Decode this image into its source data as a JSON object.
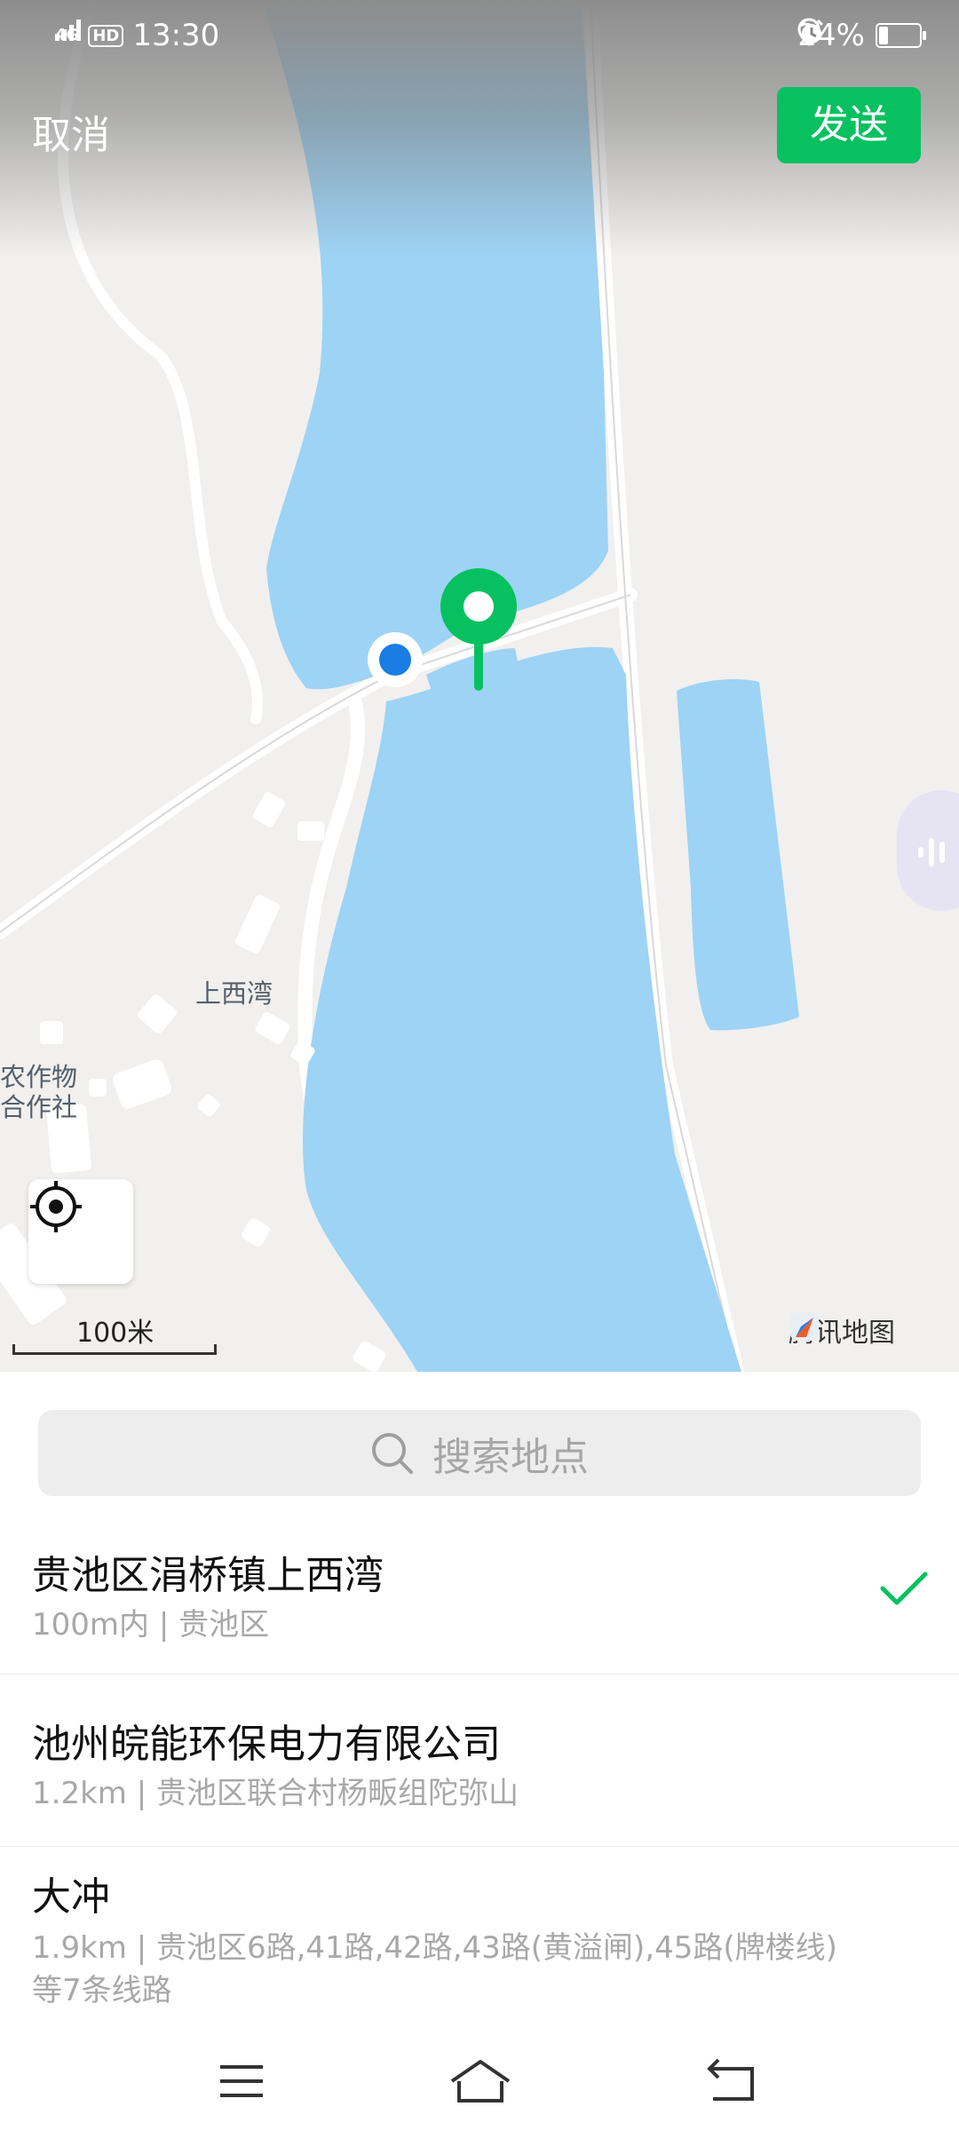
{
  "status_bar": {
    "network": "4G",
    "hd": "HD",
    "time": "13:30",
    "battery": "24%",
    "battery_level": 0.24
  },
  "header": {
    "cancel_label": "取消",
    "send_label": "发送"
  },
  "map": {
    "labels": {
      "village": "上西湾",
      "coop_line1": "农作物",
      "coop_line2": "合作社"
    },
    "scale": "100米",
    "provider": "腾讯地图"
  },
  "search": {
    "placeholder": "搜索地点"
  },
  "results": [
    {
      "title": "贵池区涓桥镇上西湾",
      "subtitle": "100m内 | 贵池区",
      "selected": true
    },
    {
      "title": "池州皖能环保电力有限公司",
      "subtitle": "1.2km | 贵池区联合村杨畈组陀弥山",
      "selected": false
    },
    {
      "title": "大冲",
      "subtitle": "1.9km | 贵池区6路,41路,42路,43路(黄溢闸),45路(牌楼线)等7条线路",
      "selected": false
    }
  ],
  "colors": {
    "accent": "#07c160",
    "water": "#9dd3f5",
    "user_dot": "#1a7de3"
  }
}
